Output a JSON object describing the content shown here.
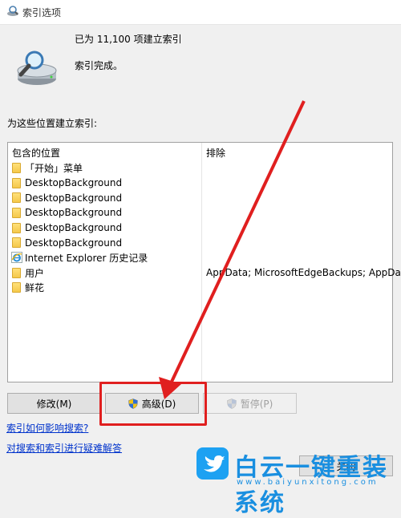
{
  "window": {
    "title": "索引选项"
  },
  "status": {
    "count_text": "已为 11,100 项建立索引",
    "state_text": "索引完成。"
  },
  "section_label": "为这些位置建立索引:",
  "list": {
    "header_included": "包含的位置",
    "header_excluded": "排除",
    "rows": [
      {
        "name": "「开始」菜单",
        "icon": "folder-icon",
        "excluded": ""
      },
      {
        "name": "DesktopBackground",
        "icon": "folder-icon",
        "excluded": ""
      },
      {
        "name": "DesktopBackground",
        "icon": "folder-icon",
        "excluded": ""
      },
      {
        "name": "DesktopBackground",
        "icon": "folder-icon",
        "excluded": ""
      },
      {
        "name": "DesktopBackground",
        "icon": "folder-icon",
        "excluded": ""
      },
      {
        "name": "DesktopBackground",
        "icon": "folder-icon",
        "excluded": ""
      },
      {
        "name": "Internet Explorer 历史记录",
        "icon": "internet-explorer-icon",
        "excluded": ""
      },
      {
        "name": "用户",
        "icon": "folder-icon",
        "excluded": "AppData; MicrosoftEdgeBackups; AppData"
      },
      {
        "name": "鲜花",
        "icon": "folder-icon",
        "excluded": ""
      }
    ]
  },
  "buttons": {
    "modify": "修改(M)",
    "advanced": "高级(D)",
    "pause": "暂停(P)",
    "close": "关闭"
  },
  "links": {
    "how_index_affects": "索引如何影响搜索?",
    "troubleshoot": "对搜索和索引进行疑难解答"
  },
  "watermark": {
    "title": "白云一键重装系统",
    "url": "www.baiyunxitong.com"
  },
  "colors": {
    "annotation_red": "#e01f1f",
    "link_blue": "#0033cc",
    "watermark_blue": "#1a8fe0"
  }
}
